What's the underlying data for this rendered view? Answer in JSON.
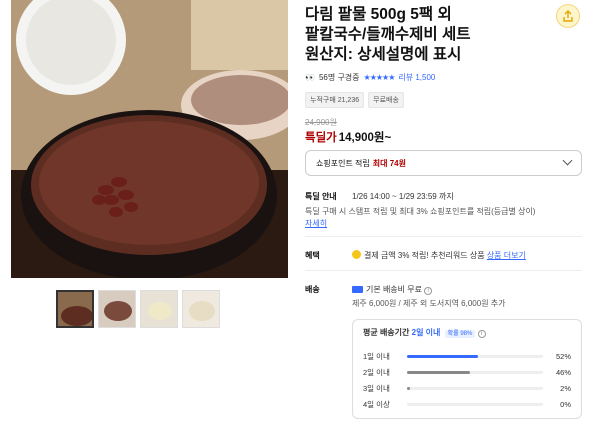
{
  "product": {
    "title_line1": "다림 팥물 500g 5팩 외",
    "title_line2": "팥칼국수/들깨수제비 세트",
    "title_line3": "원산지: 상세설명에 표시"
  },
  "rating": {
    "buyers": "56명 구경중",
    "stars": "★★★★★",
    "reviews": "리뷰 1,500"
  },
  "chips": [
    "누적구매 21,236",
    "무료배송"
  ],
  "price": {
    "original": "24,900원",
    "sale_label": "특딜가",
    "sale_price": "14,900원~"
  },
  "point_box": {
    "label": "쇼핑포인트 적립",
    "max": "최대 74원"
  },
  "deal": {
    "label": "특딜 안내",
    "period": "1/26 14:00 ~ 1/29 23:59 까지",
    "desc": "특딜 구매 시 스탬프 적립 및 최대 3% 쇼핑포인트를 적립(등급별 상이)",
    "link": "자세히"
  },
  "benefit": {
    "label": "혜택",
    "text": "결제 금액 3% 적립! 추천리워드 상품",
    "link": "상품 더보기"
  },
  "delivery": {
    "label": "배송",
    "fee": "기본 배송비 무료",
    "extra": "제주 6,000원 / 제주 외 도서지역 6,000원 추가"
  },
  "distribution": {
    "title_prefix": "평균 배송기간",
    "title_value": "2일 이내",
    "badge": "확률 98%",
    "rows": [
      {
        "label": "1일 이내",
        "percent": 52,
        "text": "52%",
        "color": "#346aff"
      },
      {
        "label": "2일 이내",
        "percent": 46,
        "text": "46%",
        "color": "#888888"
      },
      {
        "label": "3일 이내",
        "percent": 2,
        "text": "2%",
        "color": "#888888"
      },
      {
        "label": "4일 이상",
        "percent": 0,
        "text": "0%",
        "color": "#888888"
      }
    ]
  },
  "colors": {
    "accent": "#346aff",
    "sale": "#ae0000"
  }
}
